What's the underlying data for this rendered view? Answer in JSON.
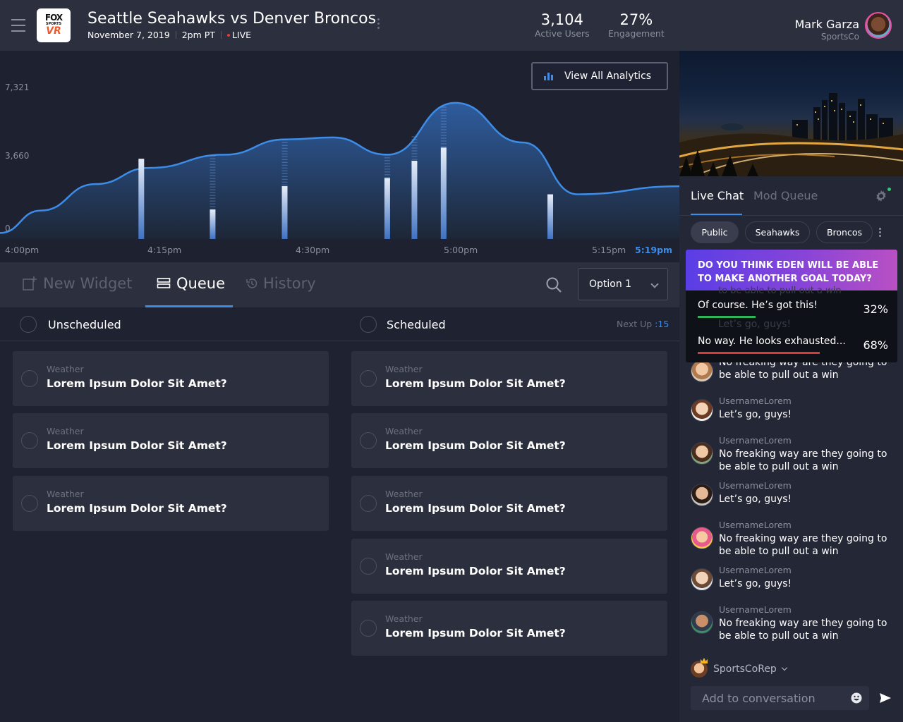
{
  "header": {
    "logo": {
      "line1": "FOX",
      "line2": "SPORTS",
      "line3": "VR"
    },
    "title": "Seattle Seahawks vs Denver Broncos",
    "date": "November 7, 2019",
    "time": "2pm PT",
    "live": "LIVE",
    "stats": [
      {
        "value": "3,104",
        "label": "Active Users"
      },
      {
        "value": "27%",
        "label": "Engagement"
      }
    ],
    "user": {
      "name": "Mark Garza",
      "org": "SportsCo"
    }
  },
  "chart_data": {
    "type": "area",
    "x_tick_labels": [
      "4:00pm",
      "4:15pm",
      "4:30pm",
      "5:00pm",
      "5:15pm",
      "5:19pm"
    ],
    "y_tick_labels": [
      "7,321",
      "3,660",
      "0"
    ],
    "ylim": [
      0,
      7321
    ],
    "curve": [
      {
        "t": 0,
        "v": 300
      },
      {
        "t": 6,
        "v": 1400
      },
      {
        "t": 14,
        "v": 2700
      },
      {
        "t": 22,
        "v": 3500
      },
      {
        "t": 33,
        "v": 4150
      },
      {
        "t": 42,
        "v": 4900
      },
      {
        "t": 49,
        "v": 5000
      },
      {
        "t": 57,
        "v": 4150
      },
      {
        "t": 67,
        "v": 6700
      },
      {
        "t": 77,
        "v": 4750
      },
      {
        "t": 85,
        "v": 2200
      },
      {
        "t": 100,
        "v": 2600
      }
    ],
    "markers": [
      {
        "t": 20.8,
        "v": 3950
      },
      {
        "t": 31.3,
        "v": 1450
      },
      {
        "t": 41.9,
        "v": 2600
      },
      {
        "t": 57.0,
        "v": 3000
      },
      {
        "t": 61.0,
        "v": 3850
      },
      {
        "t": 65.3,
        "v": 4500
      },
      {
        "t": 81.0,
        "v": 2200
      }
    ],
    "dotted_markers": [
      31.3,
      41.9,
      57.0,
      61.0,
      65.3
    ],
    "colors": {
      "accent": "#3d8ce8",
      "fill_top": "#2f5fa3",
      "fill_bottom": "#1d2636"
    },
    "grid": false
  },
  "analytics_button": {
    "label": "View All Analytics"
  },
  "tabs": [
    {
      "label": "New Widget",
      "active": false
    },
    {
      "label": "Queue",
      "active": true
    },
    {
      "label": "History",
      "active": false
    }
  ],
  "select": {
    "value": "Option 1"
  },
  "queue": {
    "unscheduled": {
      "title": "Unscheduled",
      "items": [
        {
          "category": "Weather",
          "question": "Lorem Ipsum Dolor Sit Amet?"
        },
        {
          "category": "Weather",
          "question": "Lorem Ipsum Dolor Sit Amet?"
        },
        {
          "category": "Weather",
          "question": "Lorem Ipsum Dolor Sit Amet?"
        }
      ]
    },
    "scheduled": {
      "title": "Scheduled",
      "next_up_label": "Next Up",
      "next_up_value": ":15",
      "items": [
        {
          "category": "Weather",
          "question": "Lorem Ipsum Dolor Sit Amet?"
        },
        {
          "category": "Weather",
          "question": "Lorem Ipsum Dolor Sit Amet?"
        },
        {
          "category": "Weather",
          "question": "Lorem Ipsum Dolor Sit Amet?"
        },
        {
          "category": "Weather",
          "question": "Lorem Ipsum Dolor Sit Amet?"
        },
        {
          "category": "Weather",
          "question": "Lorem Ipsum Dolor Sit Amet?"
        }
      ]
    }
  },
  "chat": {
    "tabs": [
      {
        "label": "Live Chat",
        "active": true
      },
      {
        "label": "Mod Queue",
        "active": false
      }
    ],
    "filters": [
      {
        "label": "Public",
        "selected": true
      },
      {
        "label": "Seahawks",
        "selected": false
      },
      {
        "label": "Broncos",
        "selected": false
      }
    ],
    "poll": {
      "question": "DO YOU THINK EDEN WILL BE ABLE TO MAKE ANOTHER GOAL TODAY?",
      "options": [
        {
          "text": "Of course. He’s got this!",
          "percent": "32%",
          "color": "#2fb45a"
        },
        {
          "text": "No way. He looks exhausted...",
          "percent": "68%",
          "color": "#d93a3a"
        }
      ]
    },
    "messages": [
      {
        "username": "",
        "text": "No freaking way are they going to be able to pull out a win"
      },
      {
        "username": "UsernameLorem",
        "text": "Let’s go, guys!"
      },
      {
        "username": "UsernameLorem",
        "text": "No freaking way are they going to be able to pull out a win"
      },
      {
        "username": "UsernameLorem",
        "text": "Let’s go, guys!"
      },
      {
        "username": "UsernameLorem",
        "text": "No freaking way are they going to be able to pull out a win"
      },
      {
        "username": "UsernameLorem",
        "text": "Let’s go, guys!"
      },
      {
        "username": "UsernameLorem",
        "text": "No freaking way are they going to be able to pull out a win"
      }
    ],
    "behind_poll_snippets": [
      "to be able to pull out a win",
      "Let’s go, guys!"
    ],
    "rep": {
      "name": "SportsCoRep"
    },
    "input_placeholder": "Add to conversation"
  }
}
